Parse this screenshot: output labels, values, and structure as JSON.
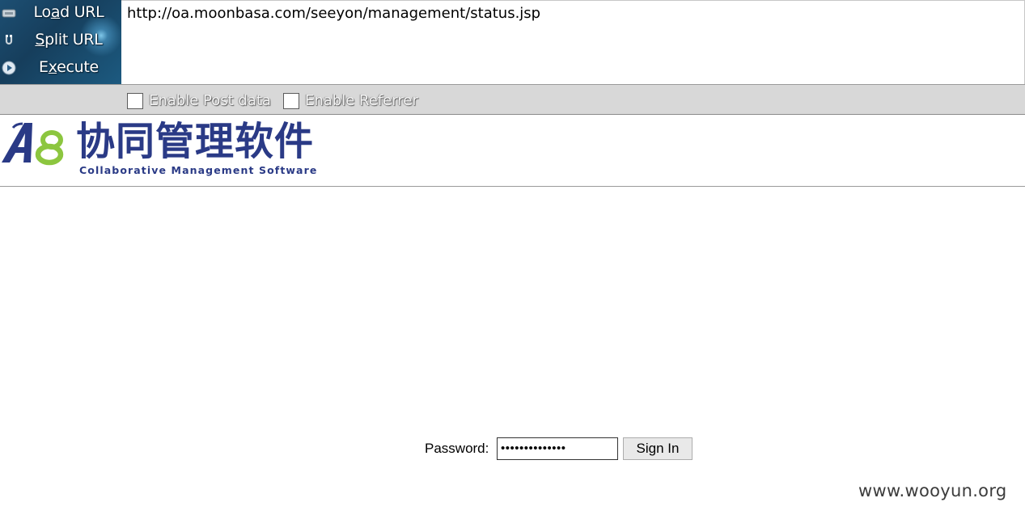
{
  "hackbar": {
    "buttons": [
      {
        "label_prefix": "Lo",
        "accesskey": "a",
        "label_suffix": "d URL",
        "icon": "load-url-icon"
      },
      {
        "label_prefix": "",
        "accesskey": "S",
        "label_suffix": "plit URL",
        "icon": "split-url-icon"
      },
      {
        "label_prefix": "E",
        "accesskey": "x",
        "label_suffix": "ecute",
        "icon": "execute-icon"
      }
    ],
    "url": "http://oa.moonbasa.com/seeyon/management/status.jsp",
    "options": [
      {
        "label": "Enable Post data",
        "checked": false
      },
      {
        "label": "Enable Referrer",
        "checked": false
      }
    ]
  },
  "page": {
    "logo": {
      "mark": "A8",
      "title_cn": "协同管理软件",
      "subtitle_en": "Collaborative Management Software"
    },
    "login": {
      "password_label": "Password:",
      "password_value": "••••••••••••••",
      "sign_in_label": "Sign In"
    }
  },
  "watermark": "www.wooyun.org",
  "colors": {
    "hackbar_bg": "#1d4f73",
    "options_bar_bg": "#d8d8d8",
    "logo_navy": "#2a3a86",
    "logo_green": "#8cc63f",
    "button_bg": "#e9e9e9"
  }
}
